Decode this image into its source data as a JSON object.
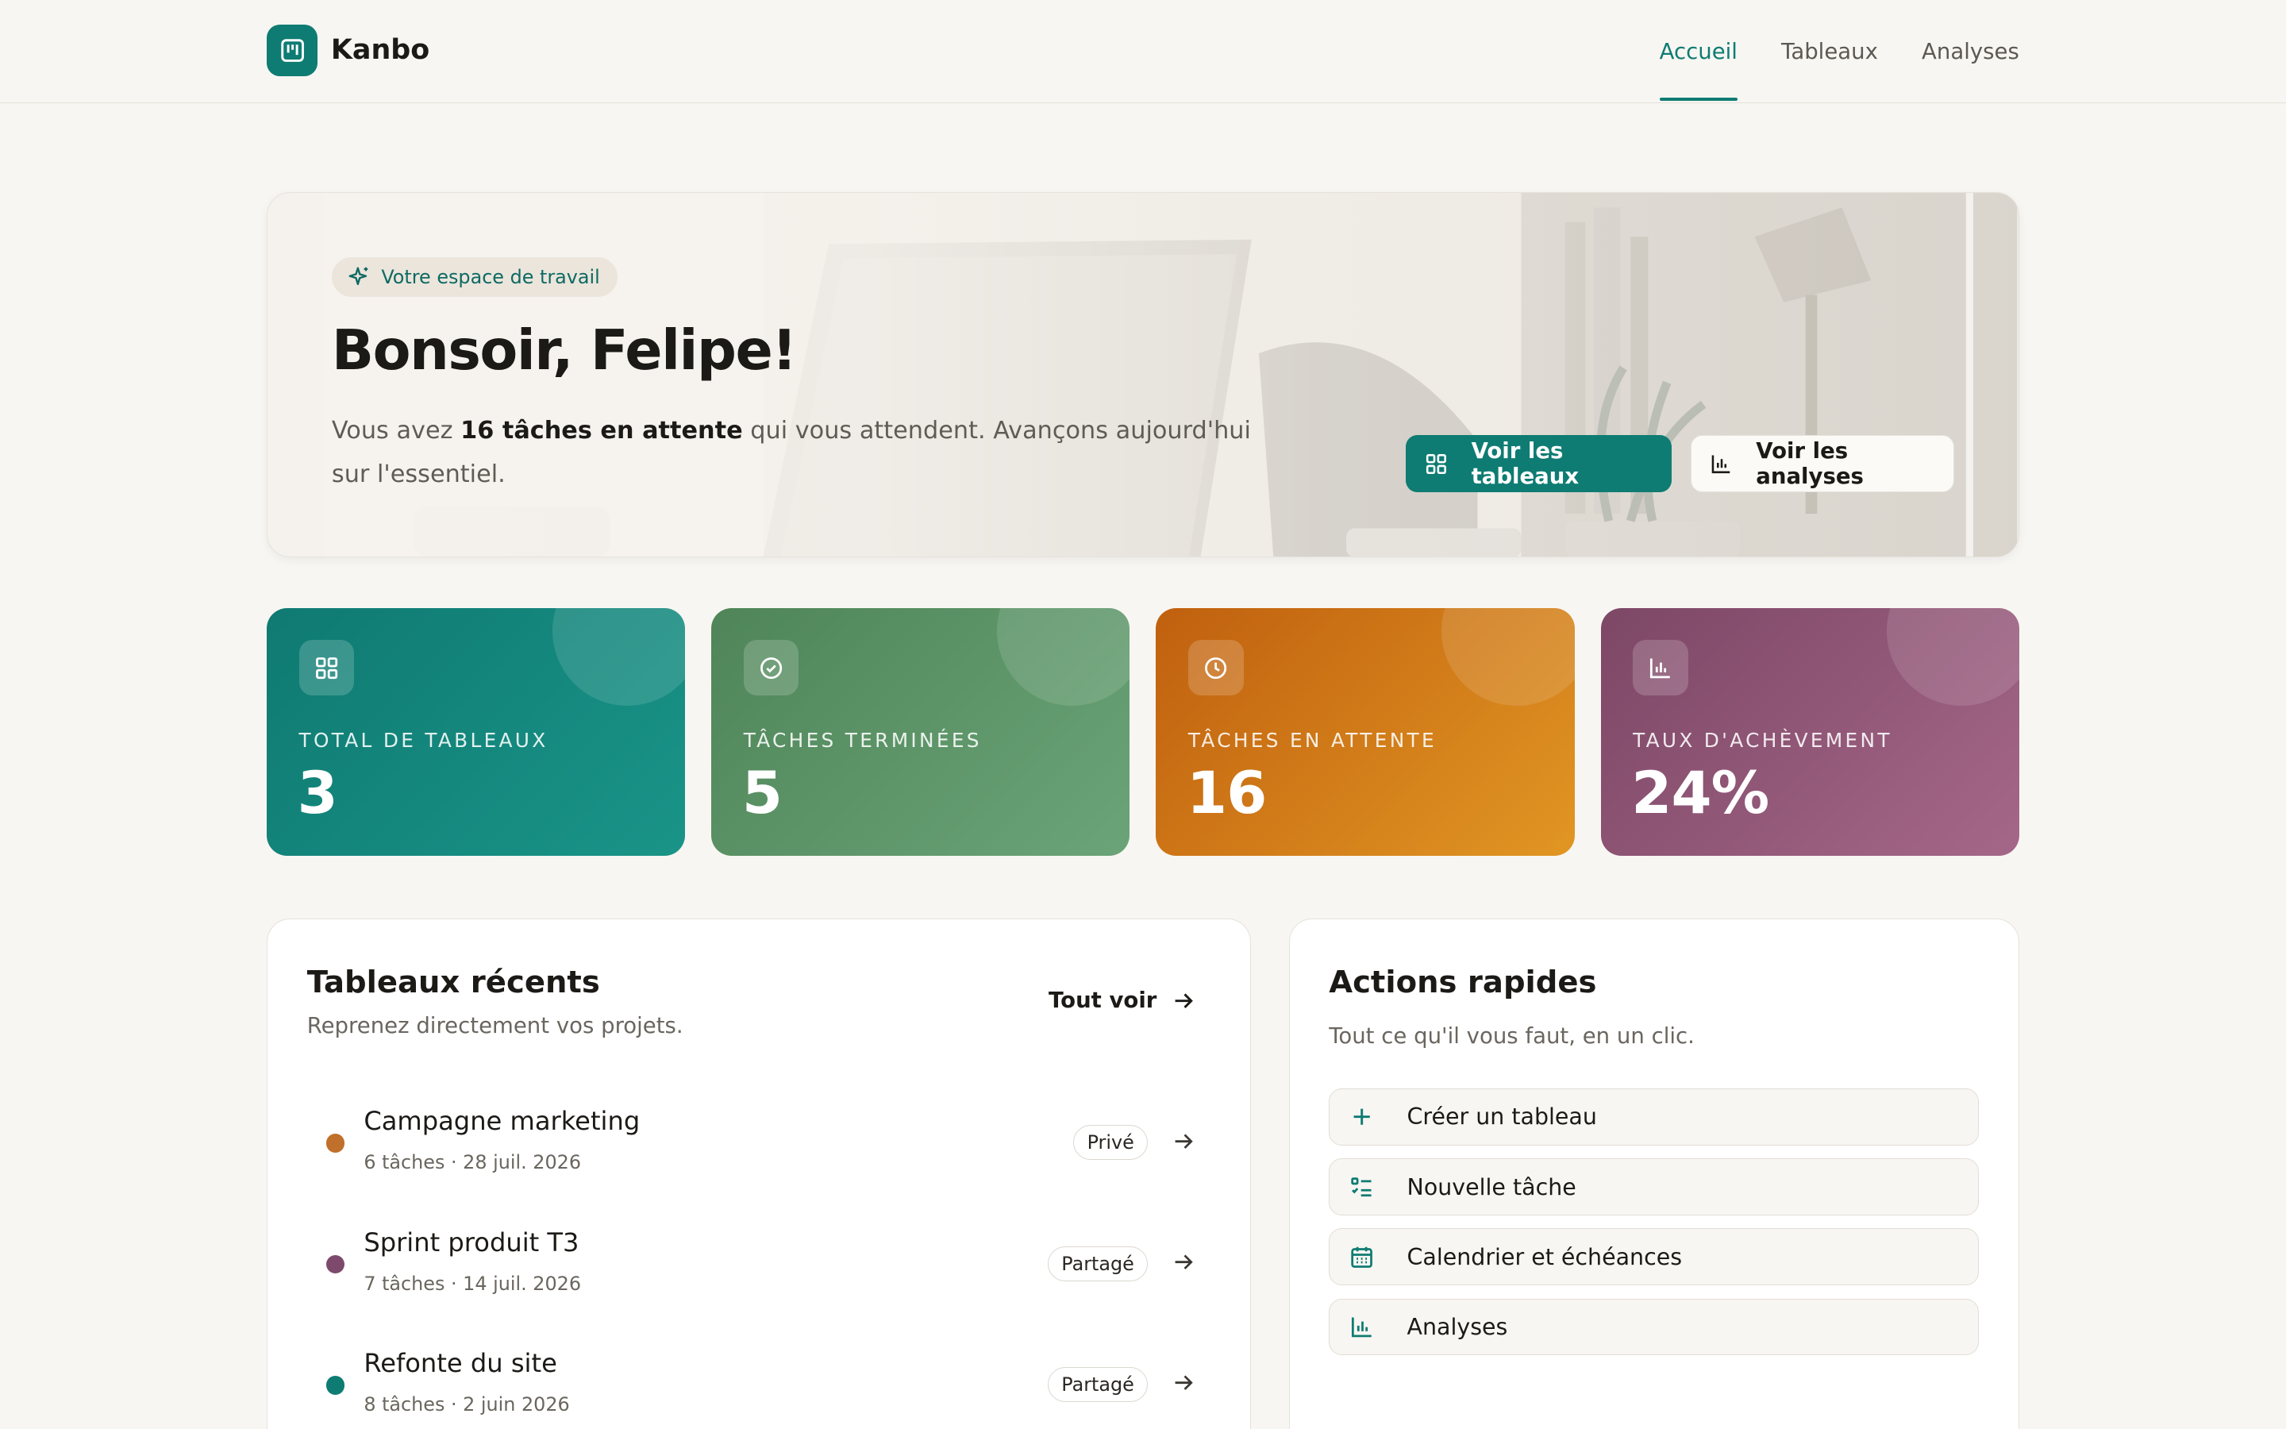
{
  "app": {
    "name": "Kanbo"
  },
  "nav": {
    "items": [
      {
        "label": "Accueil",
        "active": true
      },
      {
        "label": "Tableaux",
        "active": false
      },
      {
        "label": "Analyses",
        "active": false
      }
    ]
  },
  "hero": {
    "chip": "Votre espace de travail",
    "title": "Bonsoir, Felipe!",
    "sub_prefix": "Vous avez ",
    "sub_bold": "16 tâches en attente",
    "sub_suffix": " qui vous attendent. Avançons aujourd'hui sur l'essentiel.",
    "primary_button": "Voir les tableaux",
    "secondary_button": "Voir les analyses"
  },
  "stats": [
    {
      "label": "TOTAL DE TABLEAUX",
      "value": "3",
      "icon": "grid-icon",
      "color_from": "#0f7a72",
      "color_to": "#1a9488"
    },
    {
      "label": "TÂCHES TERMINÉES",
      "value": "5",
      "icon": "check-circle-icon",
      "color_from": "#4f8558",
      "color_to": "#6aa478"
    },
    {
      "label": "TÂCHES EN ATTENTE",
      "value": "16",
      "icon": "clock-icon",
      "color_from": "#c0600f",
      "color_to": "#e19623"
    },
    {
      "label": "TAUX D'ACHÈVEMENT",
      "value": "24%",
      "icon": "bar-chart-icon",
      "color_from": "#7d4766",
      "color_to": "#a56788"
    }
  ],
  "recent": {
    "title": "Tableaux récents",
    "subtitle": "Reprenez directement vos projets.",
    "see_all": "Tout voir",
    "items": [
      {
        "name": "Campagne marketing",
        "meta": "6 tâches · 28 juil. 2026",
        "badge": "Privé",
        "dot": "#c0702a"
      },
      {
        "name": "Sprint produit T3",
        "meta": "7 tâches · 14 juil. 2026",
        "badge": "Partagé",
        "dot": "#7d4a6c"
      },
      {
        "name": "Refonte du site",
        "meta": "8 tâches · 2 juin 2026",
        "badge": "Partagé",
        "dot": "#0e7c73"
      }
    ]
  },
  "quick": {
    "title": "Actions rapides",
    "subtitle": "Tout ce qu'il vous faut, en un clic.",
    "items": [
      {
        "label": "Créer un tableau",
        "icon": "plus-icon"
      },
      {
        "label": "Nouvelle tâche",
        "icon": "checklist-icon"
      },
      {
        "label": "Calendrier et échéances",
        "icon": "calendar-icon"
      },
      {
        "label": "Analyses",
        "icon": "bar-chart-icon"
      }
    ]
  },
  "colors": {
    "accent": "#0e7c73",
    "background": "#f8f6f2"
  }
}
